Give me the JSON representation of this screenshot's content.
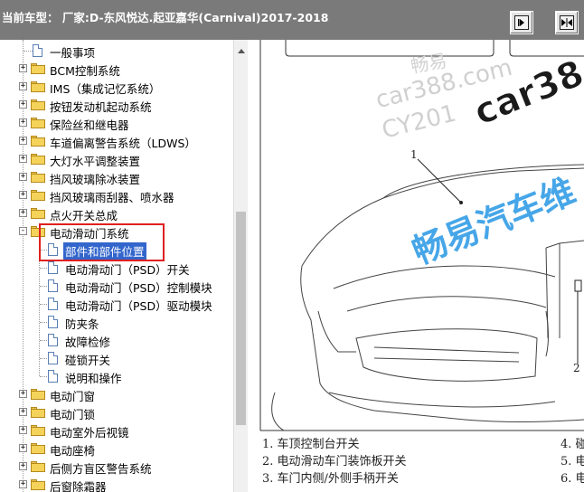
{
  "header": {
    "title": "当前车型：  厂家:D-东风悦达.起亚嘉华(Carnival)2017-2018",
    "buttons": [
      {
        "icon": "collapse-pane-icon"
      },
      {
        "icon": "expand-pane-icon"
      }
    ]
  },
  "tree": {
    "top_items": [
      {
        "label": "一般事项",
        "type": "page"
      },
      {
        "label": "BCM控制系统",
        "type": "folder",
        "expander": "+"
      },
      {
        "label": "IMS（集成记忆系统）",
        "type": "folder",
        "expander": "+"
      },
      {
        "label": "按钮发动机起动系统",
        "type": "folder",
        "expander": "+"
      },
      {
        "label": "保险丝和继电器",
        "type": "folder",
        "expander": "+"
      },
      {
        "label": "车道偏离警告系统（LDWS）",
        "type": "folder",
        "expander": "+"
      },
      {
        "label": "大灯水平调整装置",
        "type": "folder",
        "expander": "+"
      },
      {
        "label": "挡风玻璃除冰装置",
        "type": "folder",
        "expander": "+"
      },
      {
        "label": "挡风玻璃雨刮器、喷水器",
        "type": "folder",
        "expander": "+"
      },
      {
        "label": "点火开关总成",
        "type": "folder",
        "expander": "+"
      }
    ],
    "expanded_item": {
      "label": "电动滑动门系统",
      "type": "folder",
      "expander": "-"
    },
    "children": [
      {
        "label": "部件和部件位置",
        "selected": true
      },
      {
        "label": "电动滑动门（PSD）开关"
      },
      {
        "label": "电动滑动门（PSD）控制模块"
      },
      {
        "label": "电动滑动门（PSD）驱动模块"
      },
      {
        "label": "防夹条"
      },
      {
        "label": "故障检修"
      },
      {
        "label": "碰锁开关"
      },
      {
        "label": "说明和操作"
      }
    ],
    "bottom_items": [
      {
        "label": "电动门窗",
        "type": "folder",
        "expander": "+"
      },
      {
        "label": "电动门锁",
        "type": "folder",
        "expander": "+"
      },
      {
        "label": "电动室外后视镜",
        "type": "folder",
        "expander": "+"
      },
      {
        "label": "电动座椅",
        "type": "folder",
        "expander": "+"
      },
      {
        "label": "后侧方盲区警告系统",
        "type": "folder",
        "expander": "+"
      },
      {
        "label": "后窗除霜器",
        "type": "folder",
        "expander": "+"
      }
    ]
  },
  "diagram": {
    "watermarks": [
      "畅易",
      "car388.com",
      "CY201",
      "car38",
      "畅易汽车维"
    ],
    "callouts": [
      "1",
      "2"
    ],
    "legend": [
      "1. 车顶控制台开关",
      "2. 电动滑动车门装饰板开关",
      "3. 车门内侧/外侧手柄开关",
      "4. 碰",
      "5. 电",
      "6. 电"
    ]
  },
  "colors": {
    "header_bg": "#7a7a7a",
    "selection": "#3366cc",
    "highlight_box": "#e02020",
    "watermark_blue": "#46a6e8"
  }
}
